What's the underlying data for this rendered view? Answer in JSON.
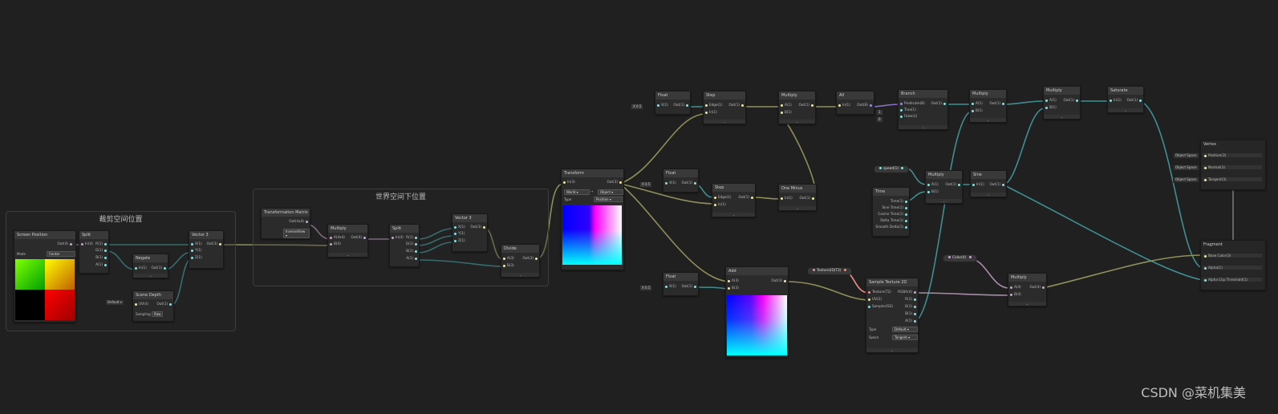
{
  "colors": {
    "background": "#202020",
    "vector_wire": "#8f8f5a",
    "float_wire": "#3f8f92",
    "matrix_wire": "#a88ba8",
    "bool_wire": "#8b6fc0",
    "color_wire": "#a88ba8"
  },
  "groups": {
    "clip_space": "裁剪空间位置",
    "world_space": "世界空间下位置"
  },
  "nodes": {
    "screen_position": {
      "title": "Screen Position",
      "out": "Out(4)",
      "mode_label": "Mode",
      "mode_value": "Center"
    },
    "split1": {
      "title": "Split",
      "in": "In(4)",
      "r": "R(1)",
      "g": "G(1)",
      "b": "B(1)",
      "a": "A(1)"
    },
    "negate": {
      "title": "Negate",
      "in": "In(1)",
      "out": "Out(1)"
    },
    "scene_depth": {
      "title": "Scene Depth",
      "in": "UV(4)",
      "out": "Out(1)",
      "default": "Default ▾",
      "sampling_label": "Sampling",
      "sampling_value": "Raw"
    },
    "vector3_a": {
      "title": "Vector 3",
      "x": "X(1)",
      "y": "Y(1)",
      "z": "Z(1)",
      "out": "Out(3)"
    },
    "trans_matrix": {
      "title": "Transformation Matrix",
      "out": "Out(4x4)",
      "dd": "InverseView ▾"
    },
    "multiply1": {
      "title": "Multiply",
      "a": "A(4x4)",
      "b": "B(4)",
      "out": "Out(4)"
    },
    "split2": {
      "title": "Split",
      "in": "In(4)",
      "r": "R(1)",
      "g": "G(1)",
      "b": "B(1)",
      "a": "A(1)"
    },
    "vector3_b": {
      "title": "Vector 3",
      "x": "X(1)",
      "y": "Y(1)",
      "z": "Z(1)",
      "out": "Out(3)"
    },
    "divide": {
      "title": "Divide",
      "a": "A(3)",
      "b": "B(3)",
      "out": "Out(3)"
    },
    "transform": {
      "title": "Transform",
      "in": "In(3)",
      "out": "Out(3)",
      "from": "World ▾",
      "to": "Object ▾",
      "type_label": "Type",
      "type_value": "Position ▾"
    },
    "float1": {
      "title": "Float",
      "in": "X(1)",
      "out": "Out(1)",
      "x_label": "X",
      "value": "0.5"
    },
    "step1": {
      "title": "Step",
      "edge": "Edge(1)",
      "in": "In(1)",
      "out": "Out(1)"
    },
    "multiply2": {
      "title": "Multiply",
      "a": "A(1)",
      "b": "B(1)",
      "out": "Out(1)"
    },
    "all": {
      "title": "All",
      "in": "In(1)",
      "out": "Out(B)"
    },
    "branch": {
      "title": "Branch",
      "pred": "Predicate(B)",
      "t": "True(1)",
      "f": "False(1)",
      "out": "Out(1)",
      "t_val": "1",
      "f_val": "0"
    },
    "multiply3": {
      "title": "Multiply",
      "a": "A(1)",
      "b": "B(1)",
      "out": "Out(1)"
    },
    "multiply4": {
      "title": "Multiply",
      "a": "A(1)",
      "b": "B(1)",
      "out": "Out(1)"
    },
    "saturate": {
      "title": "Saturate",
      "in": "In(1)",
      "out": "Out(1)"
    },
    "float2": {
      "title": "Float",
      "in": "X(1)",
      "out": "Out(1)",
      "x_label": "X",
      "value": "0.5"
    },
    "step2": {
      "title": "Step",
      "edge": "Edge(1)",
      "in": "In(1)",
      "out": "Out(1)"
    },
    "one_minus": {
      "title": "One Minus",
      "in": "In(1)",
      "out": "Out(1)"
    },
    "speed_prop": {
      "label": "speed(1)"
    },
    "multiply5": {
      "title": "Multiply",
      "a": "A(1)",
      "b": "B(1)",
      "out": "Out(1)"
    },
    "sine": {
      "title": "Sine",
      "in": "In(1)",
      "out": "Out(1)"
    },
    "time": {
      "title": "Time",
      "time": "Time(1)",
      "sine": "Sine Time(1)",
      "cosine": "Cosine Time(1)",
      "delta": "Delta Time(1)",
      "smooth": "Smooth Delta(1)"
    },
    "float3": {
      "title": "Float",
      "in": "X(1)",
      "out": "Out(1)",
      "x_label": "X",
      "value": "0.5"
    },
    "add": {
      "title": "Add",
      "a": "A(3)",
      "b": "B(3)",
      "out": "Out(3)"
    },
    "texture_prop": {
      "label": "Texture2D(T2)"
    },
    "sample_tex": {
      "title": "Sample Texture 2D",
      "tex": "Texture(T2)",
      "uv": "UV(2)",
      "sampler": "Sampler(SS)",
      "rgba": "RGBA(4)",
      "r": "R(1)",
      "g": "G(1)",
      "b": "B(1)",
      "a": "A(1)",
      "type_label": "Type",
      "type_value": "Default ▾",
      "space_label": "Space",
      "space_value": "Tangent ▾"
    },
    "color_prop": {
      "label": "Color(4)"
    },
    "multiply6": {
      "title": "Multiply",
      "a": "A(4)",
      "b": "B(4)",
      "out": "Out(4)"
    },
    "vertex": {
      "title": "Vertex",
      "pos": "Position(3)",
      "normal": "Normal(3)",
      "tangent": "Tangent(3)",
      "space1": "Object Space",
      "space2": "Object Space",
      "space3": "Object Space"
    },
    "fragment": {
      "title": "Fragment",
      "base": "Base Color(3)",
      "alpha": "Alpha(1)",
      "clip": "Alpha Clip Threshold(1)"
    }
  },
  "watermark": "CSDN @菜机集美"
}
